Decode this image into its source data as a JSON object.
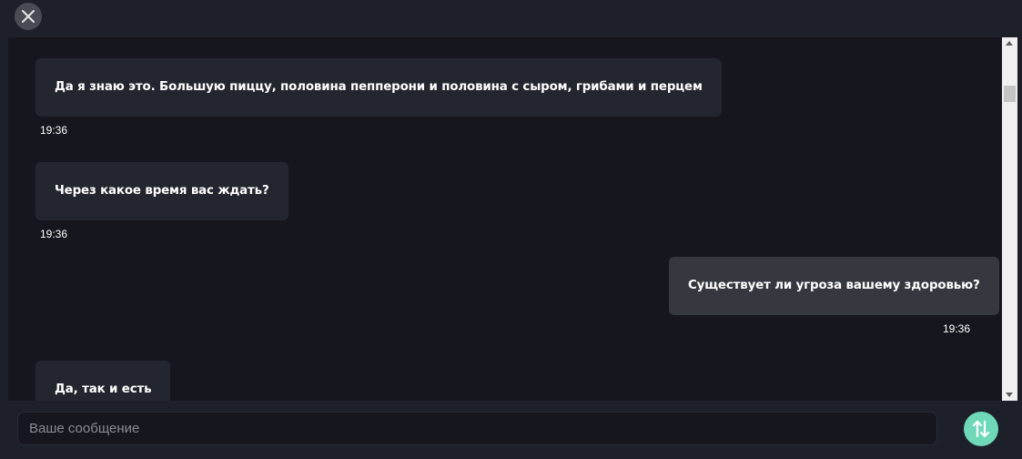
{
  "messages": [
    {
      "text": "Да я знаю это. Большую пиццу, половина пепперони и половина с сыром, грибами и перцем",
      "time": "19:36",
      "side": "in"
    },
    {
      "text": "Через какое время вас ждать?",
      "time": "19:36",
      "side": "in"
    },
    {
      "text": "Существует ли угроза вашему здоровью?",
      "time": "19:36",
      "side": "out"
    },
    {
      "text": "Да, так и есть",
      "time": "",
      "side": "in"
    }
  ],
  "composer": {
    "placeholder": "Ваше сообщение",
    "value": ""
  },
  "colors": {
    "accent": "#6ed8b8",
    "incoming_bubble": "#24262f",
    "outgoing_bubble": "#363840",
    "chat_background": "#16171e"
  }
}
